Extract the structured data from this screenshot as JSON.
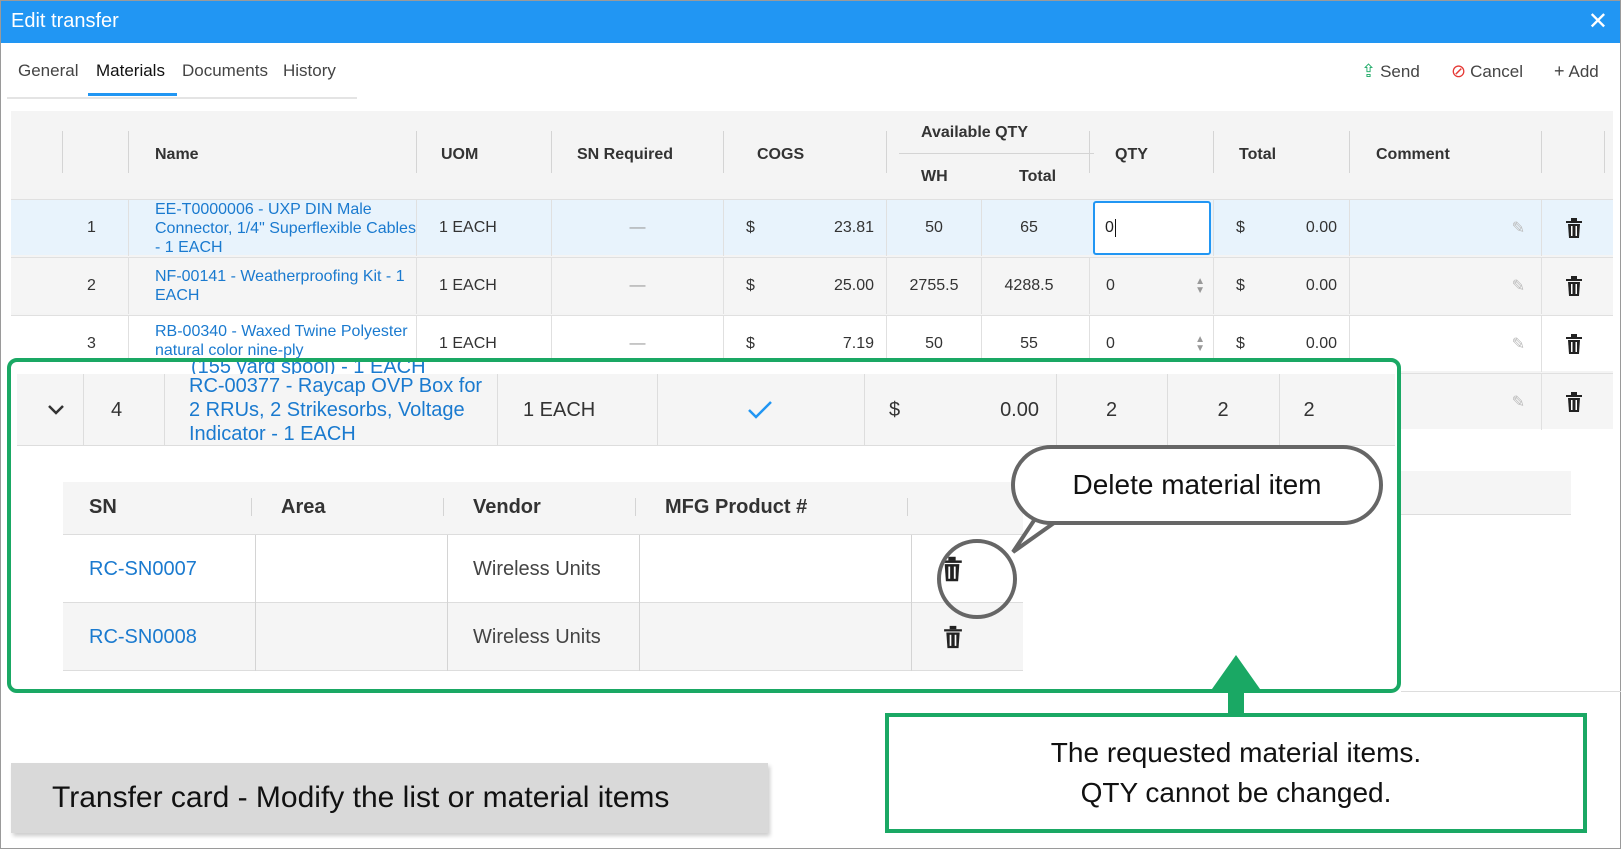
{
  "window": {
    "title": "Edit transfer"
  },
  "tabs": [
    "General",
    "Materials",
    "Documents",
    "History"
  ],
  "actions": {
    "send": "Send",
    "cancel": "Cancel",
    "add": "Add"
  },
  "table": {
    "headers": {
      "name": "Name",
      "uom": "UOM",
      "sn_required": "SN Required",
      "cogs": "COGS",
      "available_qty": "Available QTY",
      "wh": "WH",
      "total_avail": "Total",
      "qty": "QTY",
      "total": "Total",
      "comment": "Comment"
    },
    "rows": [
      {
        "num": "1",
        "name": "EE-T0000006 - UXP DIN Male Connector, 1/4\" Superflexible Cables - 1 EACH",
        "uom": "1 EACH",
        "sn": "—",
        "currency": "$",
        "cogs": "23.81",
        "wh": "50",
        "avail_total": "65",
        "qty": "0",
        "total_currency": "$",
        "total": "0.00"
      },
      {
        "num": "2",
        "name": "NF-00141 - Weatherproofing Kit - 1 EACH",
        "uom": "1 EACH",
        "sn": "—",
        "currency": "$",
        "cogs": "25.00",
        "wh": "2755.5",
        "avail_total": "4288.5",
        "qty": "0",
        "total_currency": "$",
        "total": "0.00"
      },
      {
        "num": "3",
        "name": "RB-00340 - Waxed Twine Polyester natural color nine-ply",
        "uom": "1 EACH",
        "sn": "—",
        "currency": "$",
        "cogs": "7.19",
        "wh": "50",
        "avail_total": "55",
        "qty": "0",
        "total_currency": "$",
        "total": "0.00"
      }
    ],
    "expanded_row": {
      "overflow_text": "(155 yard spool) - 1 EACH",
      "num": "4",
      "name": "RC-00377 - Raycap OVP Box for 2 RRUs, 2 Strikesorbs, Voltage Indicator - 1 EACH",
      "uom": "1 EACH",
      "currency": "$",
      "cogs": "0.00",
      "wh": "2",
      "avail_total": "2",
      "qty": "2"
    }
  },
  "sub_table": {
    "headers": {
      "sn": "SN",
      "area": "Area",
      "vendor": "Vendor",
      "mfg": "MFG Product #"
    },
    "rows": [
      {
        "sn": "RC-SN0007",
        "area": "",
        "vendor": "Wireless Units",
        "mfg": ""
      },
      {
        "sn": "RC-SN0008",
        "area": "",
        "vendor": "Wireless Units",
        "mfg": ""
      }
    ]
  },
  "annotations": {
    "delete_bubble": "Delete material item",
    "callout_line1": "The requested material items.",
    "callout_line2": "QTY cannot be changed.",
    "caption": "Transfer card - Modify the list or material items"
  },
  "colors": {
    "accent": "#2196f3",
    "green": "#1aa864",
    "link": "#1a7acf"
  }
}
